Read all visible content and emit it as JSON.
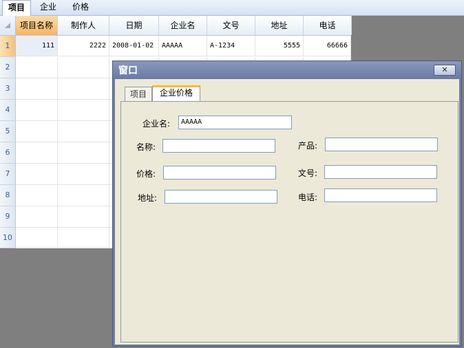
{
  "menu": {
    "items": [
      "项目",
      "企业",
      "价格"
    ]
  },
  "grid": {
    "columns": [
      "项目名称",
      "制作人",
      "日期",
      "企业名",
      "文号",
      "地址",
      "电话"
    ],
    "row_numbers": [
      "1",
      "2",
      "3",
      "4",
      "5",
      "6",
      "7",
      "8",
      "9",
      "10"
    ],
    "rows": [
      [
        "111",
        "2222",
        "2008-01-02",
        "AAAAA",
        "A-1234",
        "5555",
        "66666"
      ]
    ]
  },
  "window": {
    "title": "窗口",
    "close_symbol": "✕",
    "tabs": [
      "项目",
      "企业价格"
    ],
    "form": {
      "company_label": "企业名:",
      "company_value": "AAAAA",
      "name_label": "名称:",
      "name_value": "",
      "product_label": "产品:",
      "product_value": "",
      "price_label": "价格:",
      "price_value": "",
      "docno_label": "文号:",
      "docno_value": "",
      "address_label": "地址:",
      "address_value": "",
      "phone_label": "电话:",
      "phone_value": ""
    }
  }
}
